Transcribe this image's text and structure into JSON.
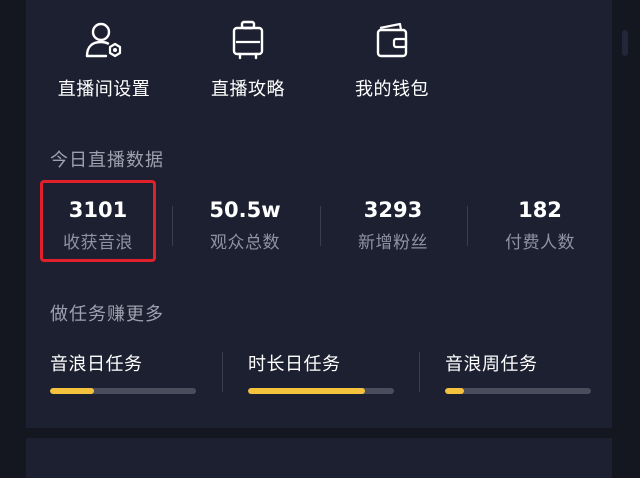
{
  "shortcuts": [
    {
      "label": "直播间设置",
      "icon": "user-settings-icon"
    },
    {
      "label": "直播攻略",
      "icon": "luggage-icon"
    },
    {
      "label": "我的钱包",
      "icon": "wallet-icon"
    }
  ],
  "today_section": {
    "title": "今日直播数据",
    "stats": [
      {
        "value": "3101",
        "label": "收获音浪"
      },
      {
        "value": "50.5w",
        "label": "观众总数"
      },
      {
        "value": "3293",
        "label": "新增粉丝"
      },
      {
        "value": "182",
        "label": "付费人数"
      }
    ]
  },
  "tasks_section": {
    "title": "做任务赚更多",
    "tasks": [
      {
        "label": "音浪日任务",
        "progress": 0.3
      },
      {
        "label": "时长日任务",
        "progress": 0.8
      },
      {
        "label": "音浪周任务",
        "progress": 0.13
      }
    ]
  },
  "colors": {
    "background": "#141620",
    "panel": "#1d2030",
    "progress_fill": "#f5c23e",
    "progress_track": "#4a4d5c",
    "highlight": "#e0202a"
  }
}
